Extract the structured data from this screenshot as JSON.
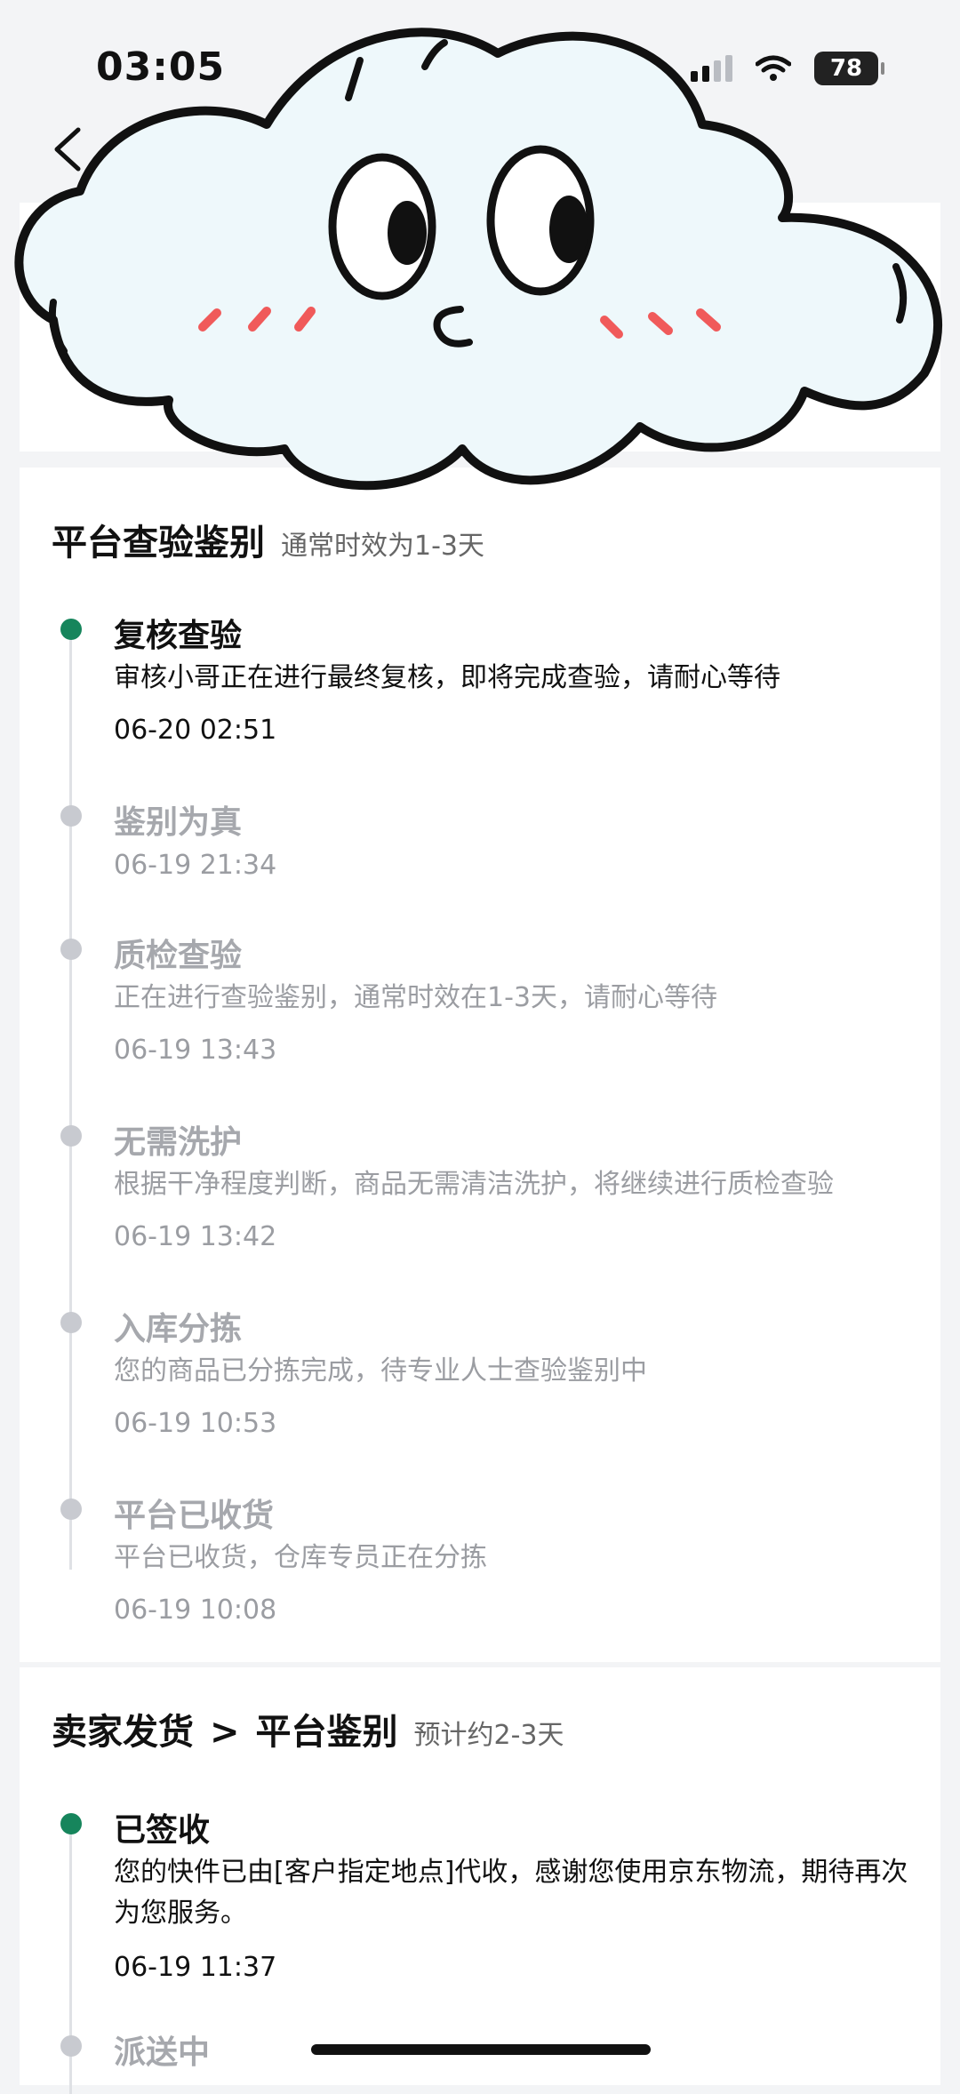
{
  "status_bar": {
    "time": "03:05",
    "battery": "78"
  },
  "platform_section": {
    "title": "平台查验鉴别",
    "subtitle": "通常时效为1-3天",
    "events": [
      {
        "title": "复核查验",
        "desc": "审核小哥正在进行最终复核，即将完成查验，请耐心等待",
        "time": "06-20 02:51",
        "active": true
      },
      {
        "title": "鉴别为真",
        "desc": "",
        "time": "06-19 21:34",
        "active": false
      },
      {
        "title": "质检查验",
        "desc": "正在进行查验鉴别，通常时效在1-3天，请耐心等待",
        "time": "06-19 13:43",
        "active": false
      },
      {
        "title": "无需洗护",
        "desc": "根据干净程度判断，商品无需清洁洗护，将继续进行质检查验",
        "time": "06-19 13:42",
        "active": false
      },
      {
        "title": "入库分拣",
        "desc": "您的商品已分拣完成，待专业人士查验鉴别中",
        "time": "06-19 10:53",
        "active": false
      },
      {
        "title": "平台已收货",
        "desc": "平台已收货，仓库专员正在分拣",
        "time": "06-19 10:08",
        "active": false
      }
    ]
  },
  "shipping_section": {
    "title_from": "卖家发货",
    "chevron": ">",
    "title_to": "平台鉴别",
    "subtitle": "预计约2-3天",
    "events": [
      {
        "title": "已签收",
        "desc": "您的快件已由[客户指定地点]代收，感谢您使用京东物流，期待再次为您服务。",
        "time": "06-19 11:37",
        "active": true
      },
      {
        "title": "派送中",
        "desc": "",
        "time": "",
        "active": false
      }
    ]
  },
  "colors": {
    "accent": "#16855c",
    "inactive": "#c8cad0"
  }
}
